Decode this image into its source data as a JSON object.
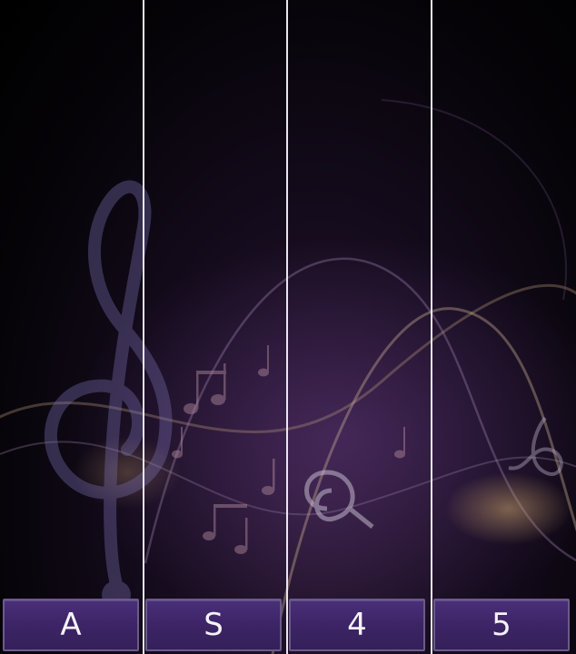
{
  "lanes": [
    {
      "key_label": "A"
    },
    {
      "key_label": "S"
    },
    {
      "key_label": "4"
    },
    {
      "key_label": "5"
    }
  ],
  "colors": {
    "key_fill": "#3d2466",
    "key_border": "#6b5a8a",
    "divider": "#e8e6ee",
    "background": "#000000"
  },
  "background_art": {
    "icons": [
      "treble-clef-icon",
      "music-notes-icon"
    ]
  }
}
